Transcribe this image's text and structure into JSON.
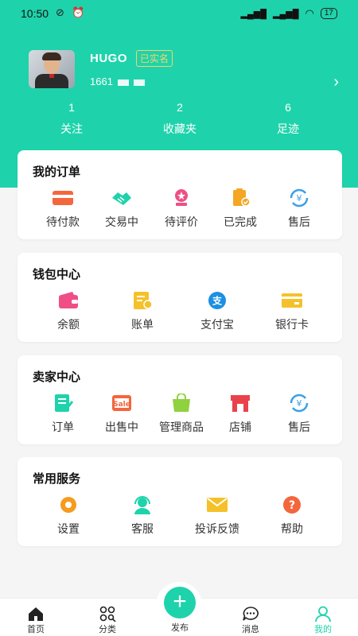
{
  "status": {
    "time": "10:50",
    "battery": "17"
  },
  "profile": {
    "name": "HUGO",
    "badge": "已实名",
    "phone": "1661"
  },
  "stats": [
    {
      "count": "1",
      "label": "关注"
    },
    {
      "count": "2",
      "label": "收藏夹"
    },
    {
      "count": "6",
      "label": "足迹"
    }
  ],
  "orders": {
    "title": "我的订单",
    "items": [
      {
        "label": "待付款",
        "icon": "card-icon"
      },
      {
        "label": "交易中",
        "icon": "handshake-icon"
      },
      {
        "label": "待评价",
        "icon": "medal-icon"
      },
      {
        "label": "已完成",
        "icon": "clipboard-check-icon"
      },
      {
        "label": "售后",
        "icon": "refund-icon"
      }
    ]
  },
  "wallet": {
    "title": "钱包中心",
    "items": [
      {
        "label": "余额",
        "icon": "wallet-icon"
      },
      {
        "label": "账单",
        "icon": "bill-icon"
      },
      {
        "label": "支付宝",
        "icon": "alipay-icon"
      },
      {
        "label": "银行卡",
        "icon": "bank-card-icon"
      }
    ]
  },
  "seller": {
    "title": "卖家中心",
    "items": [
      {
        "label": "订单",
        "icon": "order-doc-icon"
      },
      {
        "label": "出售中",
        "icon": "for-sale-icon"
      },
      {
        "label": "管理商品",
        "icon": "shopping-bag-icon"
      },
      {
        "label": "店铺",
        "icon": "store-icon"
      },
      {
        "label": "售后",
        "icon": "refund-icon"
      }
    ]
  },
  "services": {
    "title": "常用服务",
    "items": [
      {
        "label": "设置",
        "icon": "gear-icon"
      },
      {
        "label": "客服",
        "icon": "headset-icon"
      },
      {
        "label": "投诉反馈",
        "icon": "envelope-icon"
      },
      {
        "label": "帮助",
        "icon": "help-icon"
      }
    ]
  },
  "tabs": {
    "home": "首页",
    "category": "分类",
    "publish": "发布",
    "messages": "消息",
    "mine": "我的"
  },
  "colors": {
    "accent": "#1ed3ab",
    "badge": "#f6d36b"
  }
}
